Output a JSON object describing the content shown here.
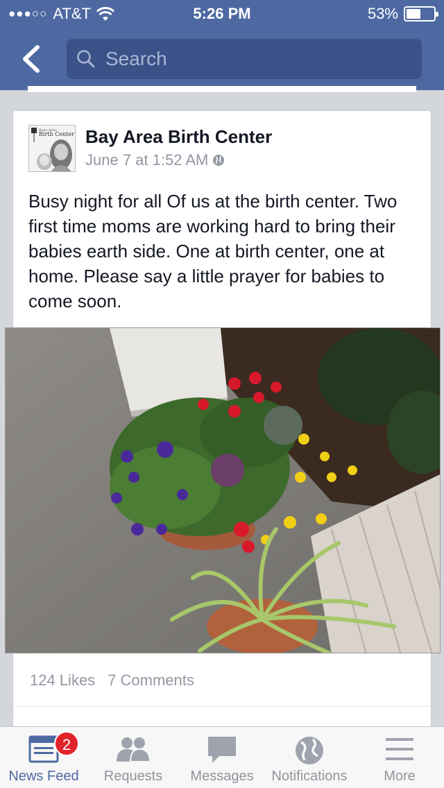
{
  "status_bar": {
    "signal": "●●●○○",
    "carrier": "AT&T",
    "time": "5:26 PM",
    "battery_percent": "53%",
    "battery_level": 0.53
  },
  "nav": {
    "back_icon": "chevron-left-icon",
    "search_placeholder": "Search",
    "search_icon": "search-icon"
  },
  "post": {
    "author": "Bay Area Birth Center",
    "timestamp": "June 7 at 1:52 AM",
    "privacy_icon": "globe-icon",
    "avatar_text": "Bay Area Birth Center",
    "text": "Busy night for all Of us at the birth center. Two first time moms are working hard to bring their babies earth side. One at birth center, one at home. Please say a little prayer for babies to come soon.",
    "likes": "124 Likes",
    "comments": "7 Comments"
  },
  "tabbar": {
    "items": [
      {
        "label": "News Feed",
        "icon": "news-feed-icon",
        "active": true,
        "badge": "2"
      },
      {
        "label": "Requests",
        "icon": "friends-icon",
        "active": false
      },
      {
        "label": "Messages",
        "icon": "chat-bubble-icon",
        "active": false
      },
      {
        "label": "Notifications",
        "icon": "globe-icon",
        "active": false
      },
      {
        "label": "More",
        "icon": "menu-icon",
        "active": false
      }
    ]
  },
  "colors": {
    "header": "#4e69a2",
    "search_bg": "#3b5289",
    "feed_bg": "#d3d6db",
    "active_tab": "#4e69a2",
    "badge": "#e1222a"
  }
}
